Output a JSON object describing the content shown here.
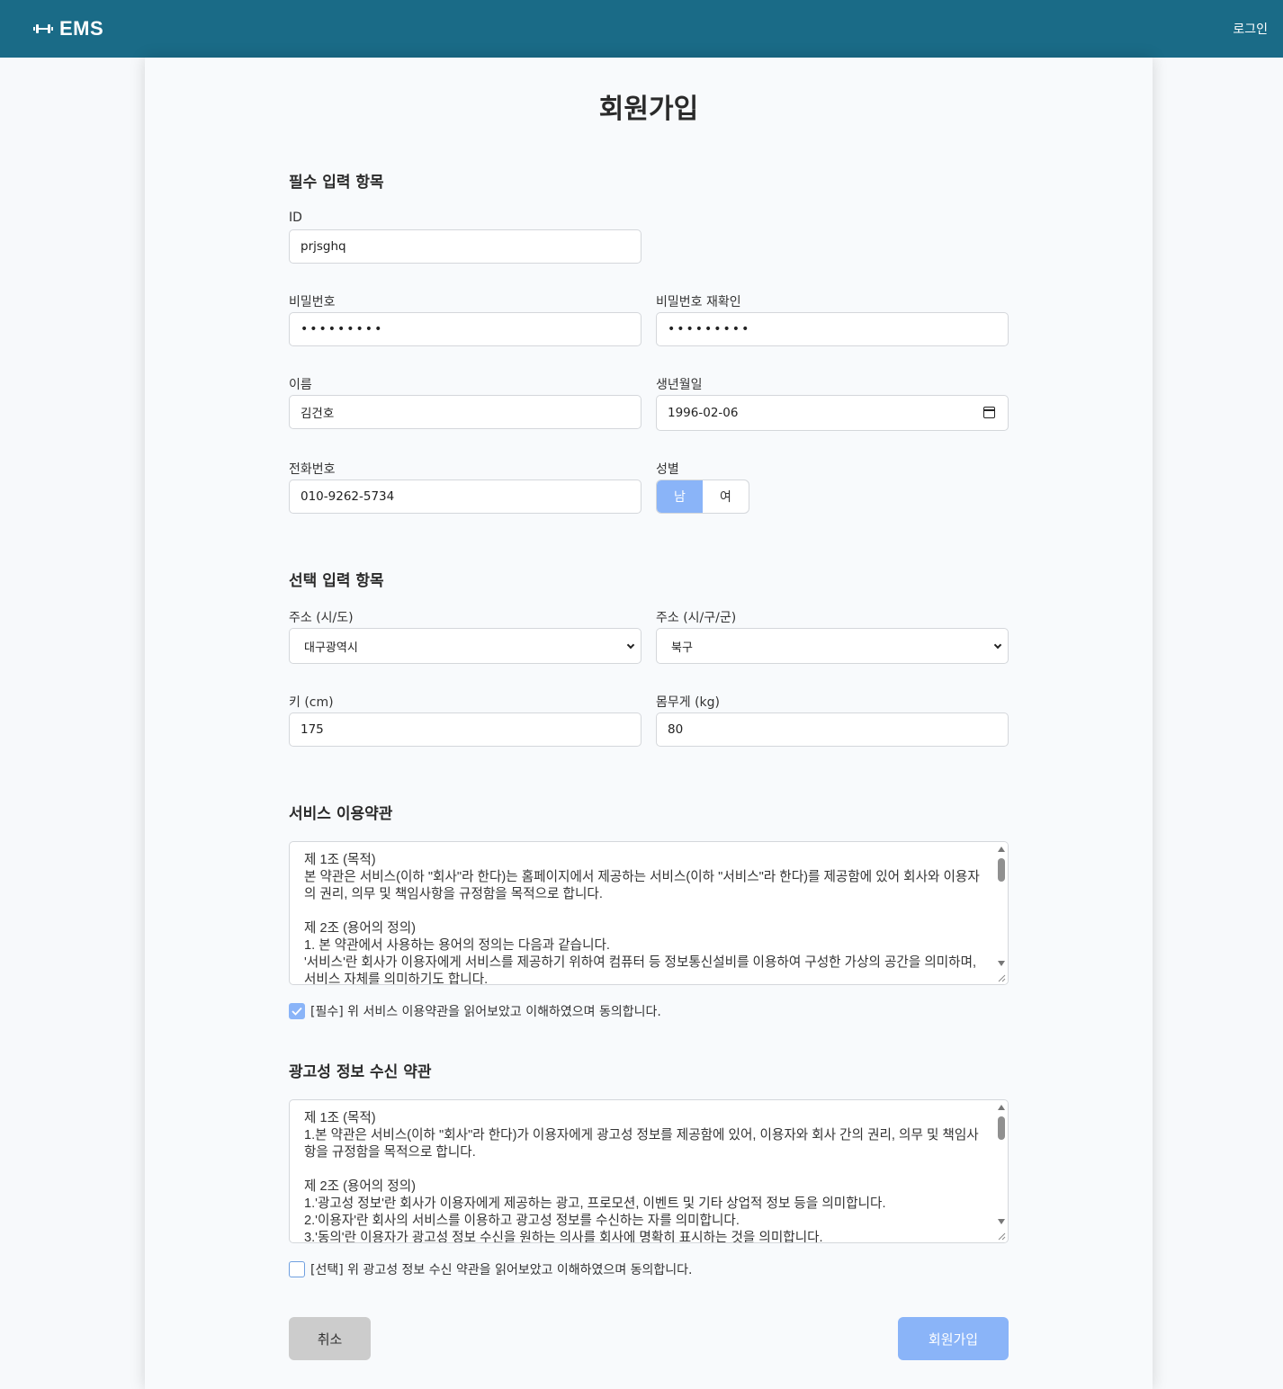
{
  "header": {
    "brand": "EMS",
    "brand_icon": "dumbbell-icon",
    "login": "로그인",
    "bg_color": "#1a6b87"
  },
  "page": {
    "title": "회원가입"
  },
  "required_section": {
    "title": "필수 입력 항목",
    "id_label": "ID",
    "id_value": "prjsghq",
    "password_label": "비밀번호",
    "password_value": "•••••••••",
    "password_confirm_label": "비밀번호 재확인",
    "password_confirm_value": "•••••••••",
    "name_label": "이름",
    "name_value": "김건호",
    "birth_label": "생년월일",
    "birth_value": "1996-02-06",
    "phone_label": "전화번호",
    "phone_value": "010-9262-5734",
    "gender_label": "성별",
    "gender_options": [
      "남",
      "여"
    ],
    "gender_selected": "남"
  },
  "optional_section": {
    "title": "선택 입력 항목",
    "city_label": "주소 (시/도)",
    "city_value": "대구광역시",
    "district_label": "주소 (시/구/군)",
    "district_value": "북구",
    "height_label": "키 (cm)",
    "height_value": "175",
    "weight_label": "몸무게 (kg)",
    "weight_value": "80"
  },
  "service_terms": {
    "title": "서비스 이용약관",
    "text": "제 1조 (목적)\n본 약관은 서비스(이하 \"회사\"라 한다)는 홈페이지에서 제공하는 서비스(이하 \"서비스\"라 한다)를 제공함에 있어 회사와 이용자의 권리, 의무 및 책임사항을 규정함을 목적으로 합니다.\n\n제 2조 (용어의 정의)\n1. 본 약관에서 사용하는 용어의 정의는 다음과 같습니다.\n'서비스'란 회사가 이용자에게 서비스를 제공하기 위하여 컴퓨터 등 정보통신설비를 이용하여 구성한 가상의 공간을 의미하며, 서비스 자체를 의미하기도 합니다.",
    "agree_label": "[필수] 위 서비스 이용약관을 읽어보았고 이해하였으며 동의합니다.",
    "agreed": true
  },
  "ad_terms": {
    "title": "광고성 정보 수신 약관",
    "text": "제 1조 (목적)\n1.본 약관은 서비스(이하 \"회사\"라 한다)가 이용자에게 광고성 정보를 제공함에 있어, 이용자와 회사 간의 권리, 의무 및 책임사항을 규정함을 목적으로 합니다.\n\n제 2조 (용어의 정의)\n1.'광고성 정보'란 회사가 이용자에게 제공하는 광고, 프로모션, 이벤트 및 기타 상업적 정보 등을 의미합니다.\n2.'이용자'란 회사의 서비스를 이용하고 광고성 정보를 수신하는 자를 의미합니다.\n3.'동의'란 이용자가 광고성 정보 수신을 원하는 의사를 회사에 명확히 표시하는 것을 의미합니다.",
    "agree_label": "[선택] 위 광고성 정보 수신 약관을 읽어보았고 이해하였으며 동의합니다.",
    "agreed": false
  },
  "actions": {
    "cancel": "취소",
    "submit": "회원가입"
  },
  "colors": {
    "accent": "#8ab4f8",
    "cancel_bg": "#cccccc"
  }
}
